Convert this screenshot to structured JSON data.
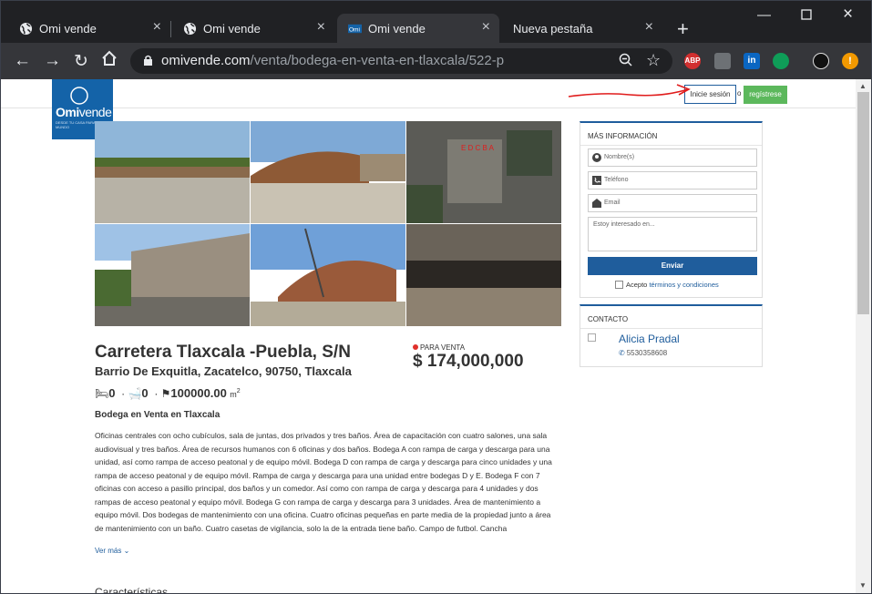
{
  "browser": {
    "tabs": [
      {
        "title": "Omi vende",
        "active": false
      },
      {
        "title": "Omi vende",
        "active": false
      },
      {
        "title": "Omi vende",
        "active": true
      },
      {
        "title": "Nueva pestaña",
        "active": false
      }
    ],
    "url_host": "omivende.com",
    "url_path": "/venta/bodega-en-venta-en-tlaxcala/522-p",
    "extensions": [
      "adblock-plus",
      "extension-icon",
      "linkedin",
      "hangouts",
      "profile",
      "update"
    ]
  },
  "header": {
    "logo_brand": "Omi",
    "logo_brand2": "vende",
    "logo_tagline": "DESDE TU CASA PARA EL MUNDO",
    "login_label": "Inicie sesión",
    "or_label": "o",
    "register_label": "regístrese"
  },
  "property": {
    "title": "Carretera Tlaxcala -Puebla, S/N",
    "subtitle": "Barrio De Exquitla, Zacatelco, 90750, Tlaxcala",
    "sale_label": "PARA VENTA",
    "price": "$ 174,000,000",
    "bedrooms": "0",
    "bathrooms": "0",
    "area": "100000.00",
    "area_unit": "m",
    "area_exp": "2",
    "description_title": "Bodega en Venta en Tlaxcala",
    "description": "Oficinas centrales con ocho cubículos, sala de juntas, dos privados y tres baños. Área de capacitación con cuatro salones, una sala audiovisual y tres baños. Área de recursos humanos con 6 oficinas y dos baños. Bodega A con rampa de carga y descarga para una unidad, así como rampa de acceso peatonal y de equipo móvil. Bodega D con rampa de carga y descarga para cinco unidades y una rampa de acceso peatonal y de equipo móvil. Rampa de carga y descarga para una unidad entre bodegas D y E. Bodega F con 7 oficinas con acceso a pasillo principal, dos baños y un comedor. Así como con rampa de carga y descarga para 4 unidades y dos rampas de acceso peatonal y equipo móvil. Bodega G con rampa de carga y descarga para 3 unidades. Área de mantenimiento a equipo móvil. Dos bodegas de mantenimiento con una oficina. Cuatro oficinas pequeñas en parte media de la propiedad junto a área de mantenimiento con un baño. Cuatro casetas de vigilancia, solo la de la entrada tiene baño. Campo de futbol. Cancha",
    "more_label": "Ver más",
    "features_heading": "Características"
  },
  "info_form": {
    "heading": "MÁS INFORMACIÓN",
    "name_placeholder": "Nombre(s)",
    "phone_placeholder": "Teléfono",
    "email_placeholder": "Email",
    "message_placeholder": "Estoy interesado en...",
    "send_label": "Enviar",
    "terms_prefix": "Acepto",
    "terms_link": "términos y condiciones"
  },
  "contact": {
    "heading": "CONTACTO",
    "agent_name": "Alicia Pradal",
    "agent_phone": "5530358608"
  },
  "colors": {
    "brand": "#1463a8",
    "link": "#1f5d9c",
    "register": "#5cb85c",
    "sale_dot": "#e0302b"
  }
}
